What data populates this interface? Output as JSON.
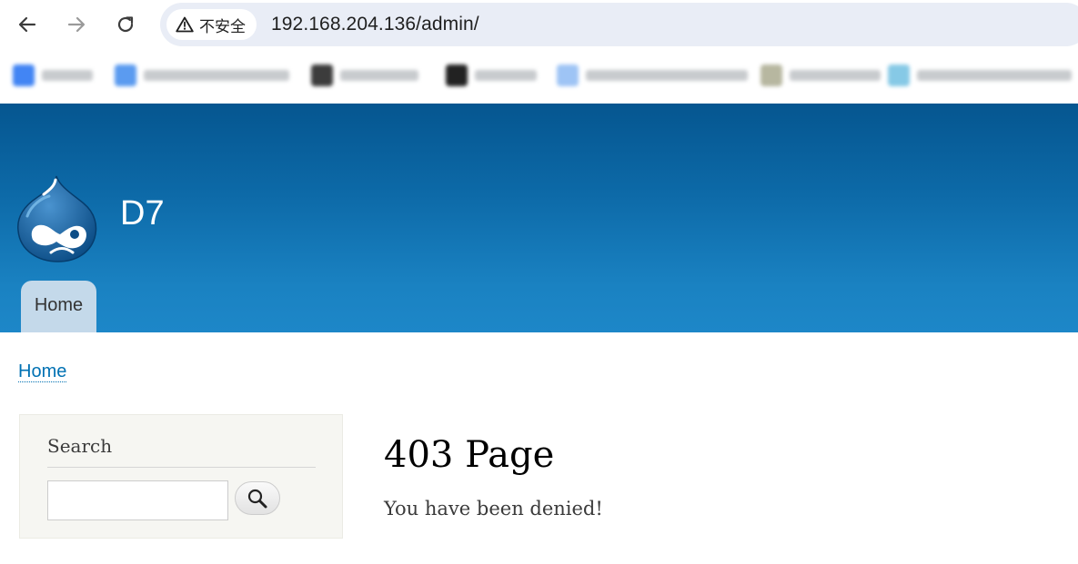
{
  "browser": {
    "security_label": "不安全",
    "url": "192.168.204.136/admin/",
    "icons": {
      "back": "arrow-left-icon",
      "forward": "arrow-right-icon",
      "reload": "reload-icon",
      "warning": "warning-triangle-icon"
    },
    "bookmarks": [
      {
        "color": "#4285f4"
      },
      {
        "color": "#5b9bf0"
      },
      {
        "color": "#3c3c3c"
      },
      {
        "color": "#222222"
      },
      {
        "color": "#9ec4f5"
      },
      {
        "color": "#b7b7a0"
      },
      {
        "color": "#86c9e6"
      }
    ]
  },
  "site": {
    "name": "D7",
    "logo": "drupal-drop-logo",
    "main_menu": [
      "Home"
    ]
  },
  "breadcrumb": "Home",
  "sidebar": {
    "search_block_title": "Search",
    "search_input_value": "",
    "search_button_icon": "magnifier-icon"
  },
  "content": {
    "title": "403 Page",
    "message": "You have been denied!"
  },
  "colors": {
    "header_top": "#055690",
    "header_bottom": "#1d87c8",
    "tab_bg": "#c4d9ea",
    "link": "#0071b3",
    "sidebar_bg": "#f6f6f2"
  }
}
